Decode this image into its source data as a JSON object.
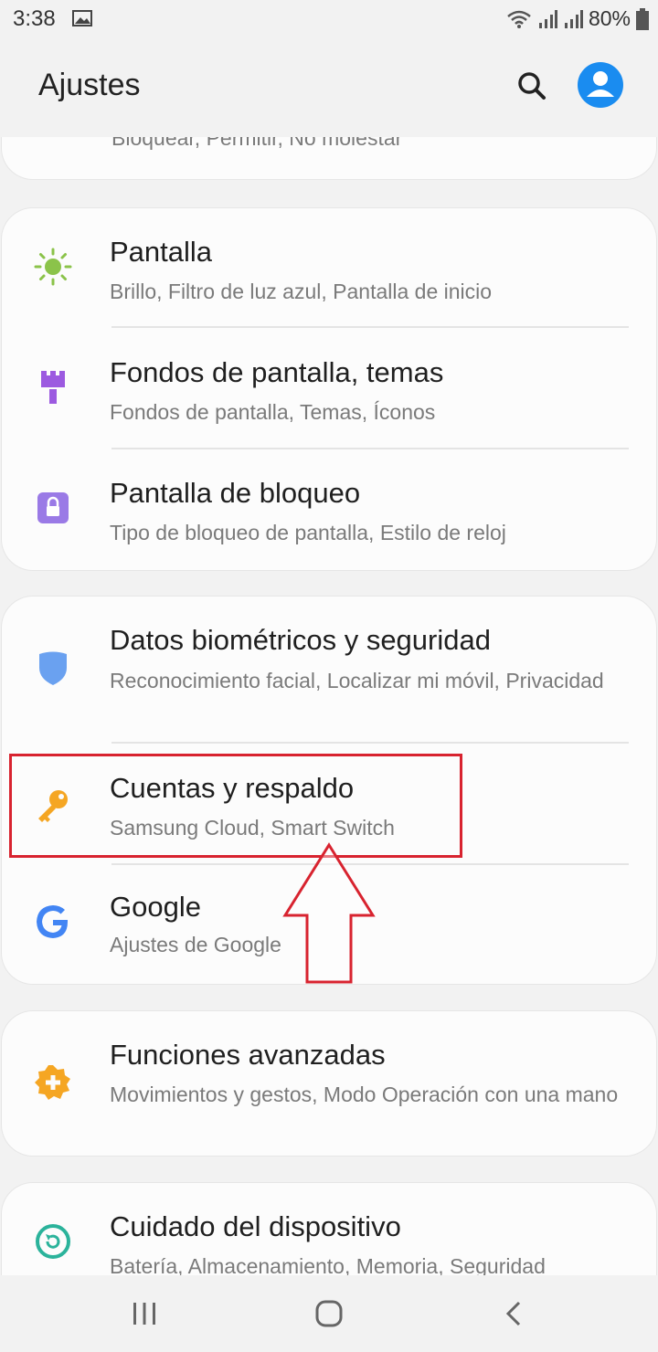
{
  "status_bar": {
    "time": "3:38",
    "battery_percent": "80%",
    "icons": [
      "gallery-icon",
      "wifi-icon",
      "signal-icon",
      "signal-icon",
      "battery-icon"
    ]
  },
  "header": {
    "title": "Ajustes",
    "icons": [
      "search-icon",
      "account-icon"
    ]
  },
  "partial_item": {
    "subtitle": "Bloquear, Permitir, No molestar"
  },
  "groups": [
    {
      "items": [
        {
          "icon": "sun-icon",
          "title": "Pantalla",
          "subtitle": "Brillo, Filtro de luz azul, Pantalla de inicio"
        },
        {
          "icon": "paint-brush-icon",
          "title": "Fondos de pantalla, temas",
          "subtitle": "Fondos de pantalla, Temas, Íconos"
        },
        {
          "icon": "lock-icon",
          "title": "Pantalla de bloqueo",
          "subtitle": "Tipo de bloqueo de pantalla, Estilo de reloj"
        }
      ]
    },
    {
      "items": [
        {
          "icon": "shield-icon",
          "title": "Datos biométricos y seguridad",
          "subtitle": "Reconocimiento facial, Localizar mi móvil, Privacidad"
        },
        {
          "icon": "key-icon",
          "title": "Cuentas y respaldo",
          "subtitle": "Samsung Cloud, Smart Switch"
        },
        {
          "icon": "google-icon",
          "title": "Google",
          "subtitle": "Ajustes de Google"
        }
      ]
    },
    {
      "items": [
        {
          "icon": "gear-plus-icon",
          "title": "Funciones avanzadas",
          "subtitle": "Movimientos y gestos, Modo Operación con una mano"
        }
      ]
    },
    {
      "items": [
        {
          "icon": "device-care-icon",
          "title": "Cuidado del dispositivo",
          "subtitle": "Batería, Almacenamiento, Memoria, Seguridad"
        }
      ]
    }
  ],
  "annotation": {
    "color": "#d8232f",
    "highlights": "Cuentas y respaldo"
  },
  "nav_bar": {
    "icons": [
      "recents-icon",
      "home-icon",
      "back-icon"
    ]
  },
  "colors": {
    "accent": "#1a8cf0",
    "sun": "#8bc34a",
    "brush": "#9c5ae0",
    "lock": "#9a7ae6",
    "shield": "#6aa1f0",
    "key": "#f5a623",
    "gear": "#f5a623",
    "device_care": "#2bb39b"
  }
}
